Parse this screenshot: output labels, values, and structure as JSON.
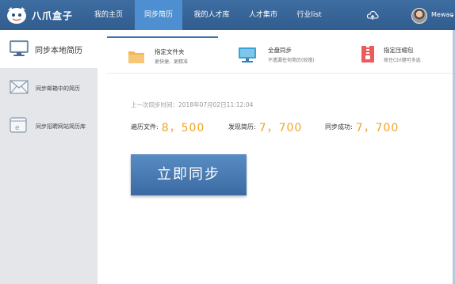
{
  "brand": {
    "name": "八爪盒子"
  },
  "nav": {
    "items": [
      {
        "label": "我的主页"
      },
      {
        "label": "同步简历"
      },
      {
        "label": "我的人才库"
      },
      {
        "label": "人才集市"
      },
      {
        "label": "行业list"
      }
    ],
    "active_index": 1
  },
  "user": {
    "name": "Mewao"
  },
  "sidebar": {
    "header": {
      "label": "同步本地简历"
    },
    "items": [
      {
        "label": "同步邮箱中的简历",
        "icon": "envelope-icon"
      },
      {
        "label": "同步招聘网站简历库",
        "icon": "browser-icon"
      }
    ]
  },
  "tabs": [
    {
      "title": "指定文件夹",
      "desc": "更快捷、更精准",
      "icon": "folder-icon"
    },
    {
      "title": "全盘同步",
      "desc": "不遗漏任何简历(较慢)",
      "icon": "monitor-icon"
    },
    {
      "title": "指定压缩包",
      "desc": "按住Ctrl键可多选",
      "icon": "zip-icon"
    }
  ],
  "sync": {
    "last_sync_label": "上一次同步时间：",
    "last_sync_time": "2018年07月02日11:12:04",
    "stats": [
      {
        "label": "遍历文件:",
        "value": "8，500"
      },
      {
        "label": "发现简历:",
        "value": "7，700"
      },
      {
        "label": "同步成功:",
        "value": "7，700"
      }
    ],
    "button_label": "立即同步"
  },
  "colors": {
    "nav_bg": "#3d6da1",
    "nav_active": "#4d8fd0",
    "accent": "#f0a428",
    "button": "#4a7bb3"
  }
}
